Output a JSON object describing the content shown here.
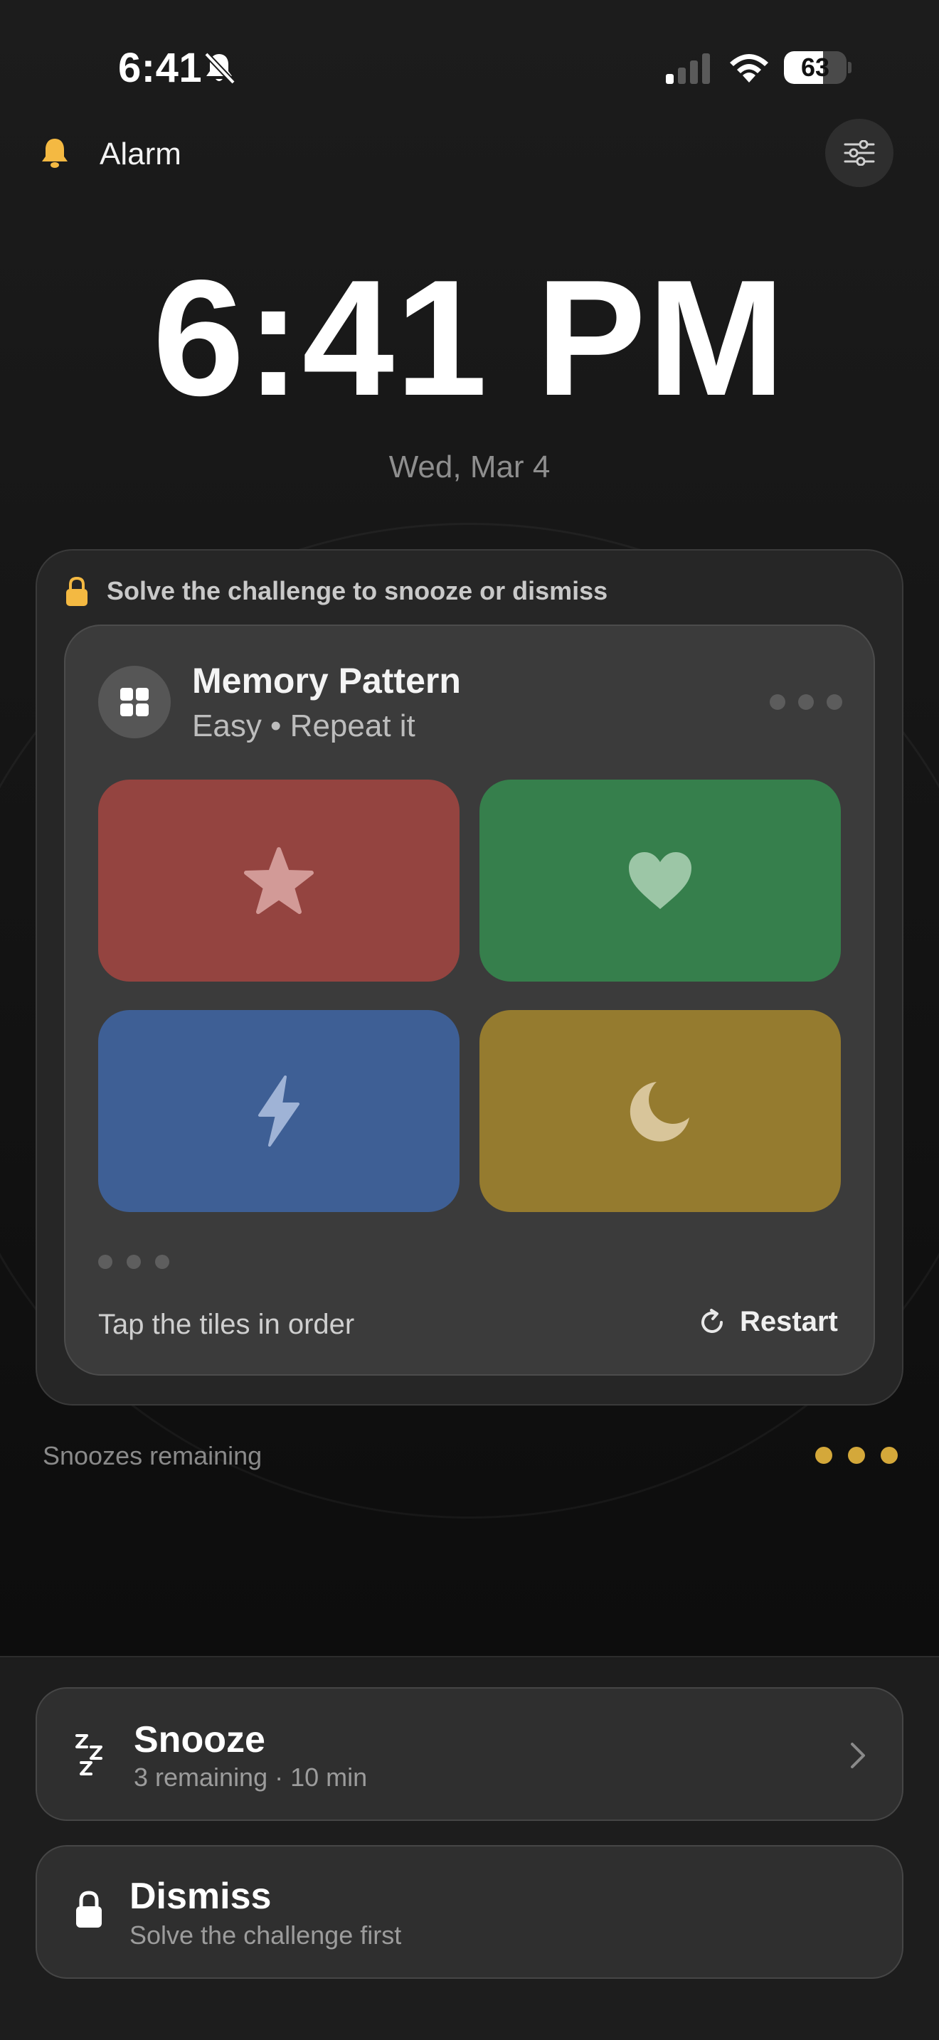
{
  "status_bar": {
    "time": "6:41",
    "battery_level": "63",
    "battery_fraction": 0.63,
    "icons": [
      "bell-slash-icon",
      "cellular-signal-icon",
      "wifi-icon",
      "battery-icon"
    ]
  },
  "header": {
    "title": "Alarm",
    "icons": [
      "bell-icon",
      "sliders-icon"
    ]
  },
  "clock": {
    "time": "6:41 PM",
    "date": "Wed, Mar 4"
  },
  "challenge": {
    "hint": "Solve the challenge to snooze or dismiss",
    "title": "Memory Pattern",
    "subtitle": "Easy • Repeat it",
    "tiles": [
      {
        "color": "#944440",
        "icon": "star-icon"
      },
      {
        "color": "#367f4c",
        "icon": "heart-icon"
      },
      {
        "color": "#3e5f95",
        "icon": "bolt-icon"
      },
      {
        "color": "#957b2f",
        "icon": "moon-icon"
      }
    ],
    "instruction": "Tap the tiles in order",
    "restart_label": "Restart"
  },
  "snoozes": {
    "label": "Snoozes remaining",
    "remaining": 3,
    "dot_color": "#d4a83a"
  },
  "actions": {
    "snooze": {
      "title": "Snooze",
      "subtitle": "3 remaining · 10 min"
    },
    "dismiss": {
      "title": "Dismiss",
      "subtitle": "Solve the challenge first"
    }
  },
  "accent_color": "#f4b942"
}
